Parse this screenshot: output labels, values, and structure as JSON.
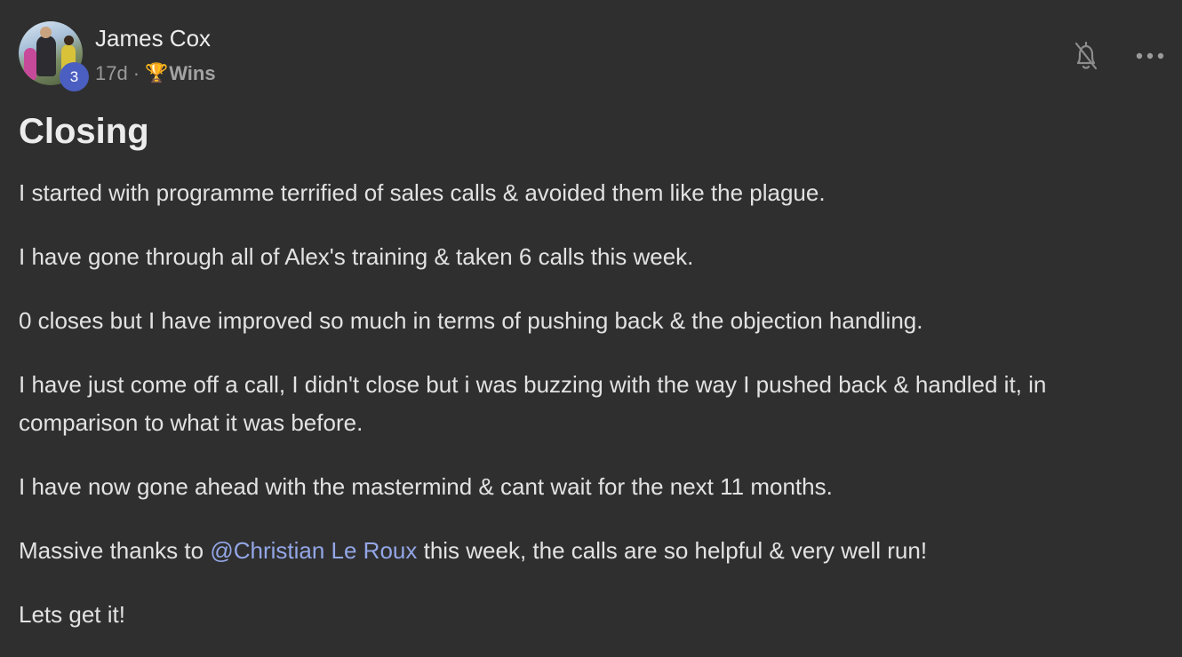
{
  "post": {
    "author": {
      "name": "James Cox",
      "level": "3",
      "avatar_icon": "avatar-photo"
    },
    "meta": {
      "age": "17d",
      "separator": "·",
      "category_icon": "trophy-icon",
      "category_emoji": "🏆",
      "category": "Wins"
    },
    "actions": {
      "notifications_icon": "bell-off-icon",
      "more_icon": "more-horizontal-icon"
    },
    "title": "Closing",
    "paragraphs": [
      "I started with programme terrified of sales calls & avoided them like the plague.",
      "I have gone through all of Alex's training & taken 6 calls this week.",
      "0 closes but I have improved so much in terms of pushing back & the objection handling.",
      "I have just come off a call, I didn't close but i was buzzing with the way I pushed back & handled it, in comparison to what it was before.",
      "I have now gone ahead with the mastermind & cant wait for the next 11 months."
    ],
    "thanks": {
      "before": "Massive thanks to ",
      "mention": "@Christian Le Roux",
      "after": " this week, the calls are so helpful & very well run!"
    },
    "closing_line": "Lets get it!"
  },
  "colors": {
    "background": "#2f2f2f",
    "text": "#e2e2e2",
    "muted": "#9a9a9a",
    "mention": "#93a6e6",
    "level_badge": "#4b5ec1"
  }
}
